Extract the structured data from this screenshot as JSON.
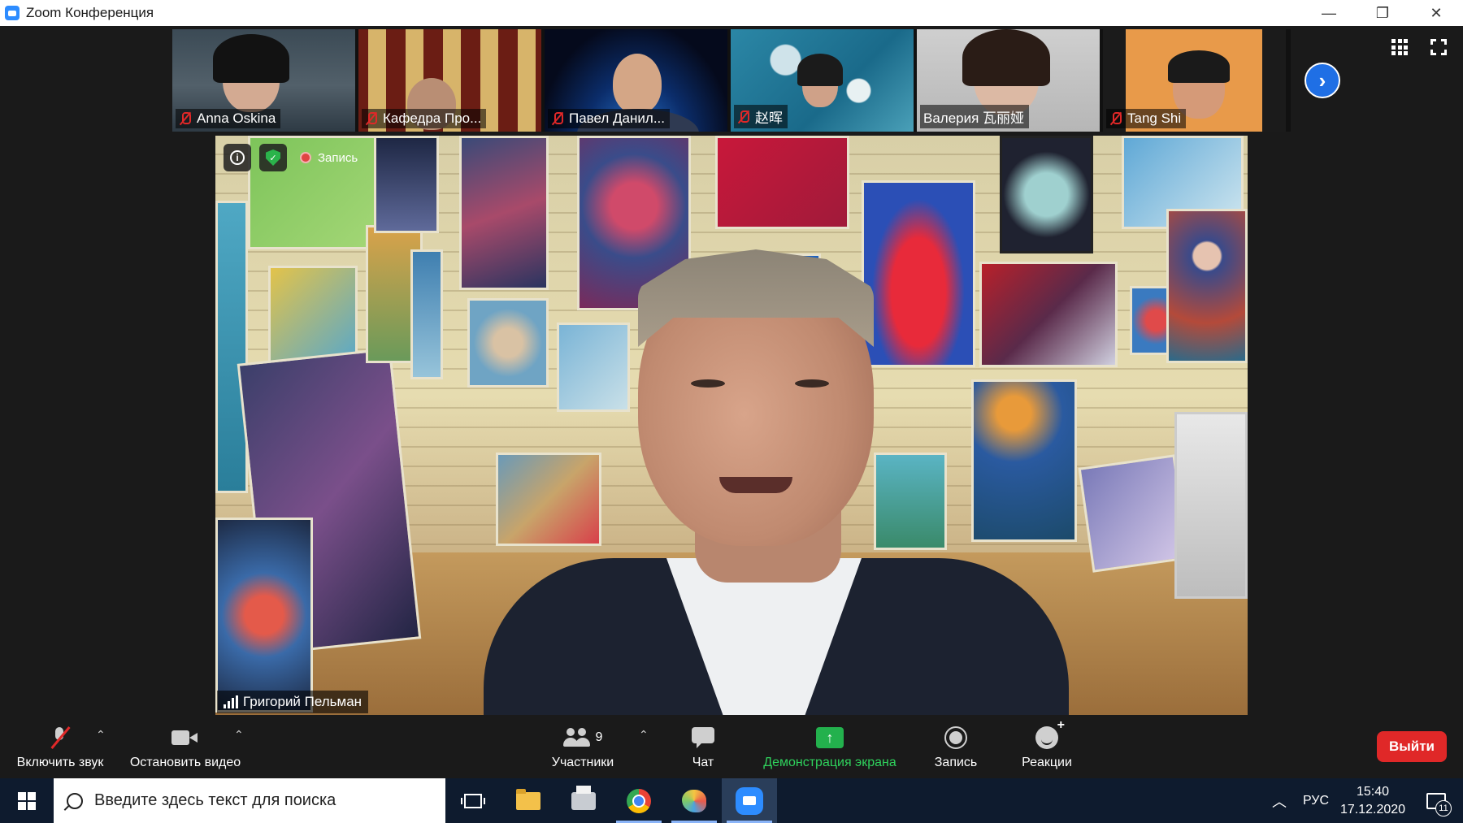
{
  "window": {
    "title": "Zoom Конференция"
  },
  "participants_strip": [
    {
      "name": "Anna Oskina",
      "muted": true
    },
    {
      "name": "Кафедра Про...",
      "muted": true
    },
    {
      "name": "Павел Данил...",
      "muted": true
    },
    {
      "name": "赵晖",
      "muted": true
    },
    {
      "name": "Валерия 瓦丽娅",
      "muted": false
    },
    {
      "name": "Tang Shi",
      "muted": true
    }
  ],
  "speaker": {
    "name": "Григорий Пельман",
    "recording_label": "Запись"
  },
  "toolbar": {
    "unmute_label": "Включить звук",
    "stop_video_label": "Остановить видео",
    "participants_label": "Участники",
    "participants_count": "9",
    "chat_label": "Чат",
    "share_label": "Демонстрация экрана",
    "record_label": "Запись",
    "reactions_label": "Реакции",
    "leave_label": "Выйти"
  },
  "taskbar": {
    "search_placeholder": "Введите здесь текст для поиска",
    "language": "РУС",
    "time": "15:40",
    "date": "17.12.2020",
    "notification_count": "11"
  },
  "colors": {
    "accent_blue": "#2d8cff",
    "share_green": "#23b14d",
    "leave_red": "#e02828",
    "muted_red": "#e02828"
  }
}
